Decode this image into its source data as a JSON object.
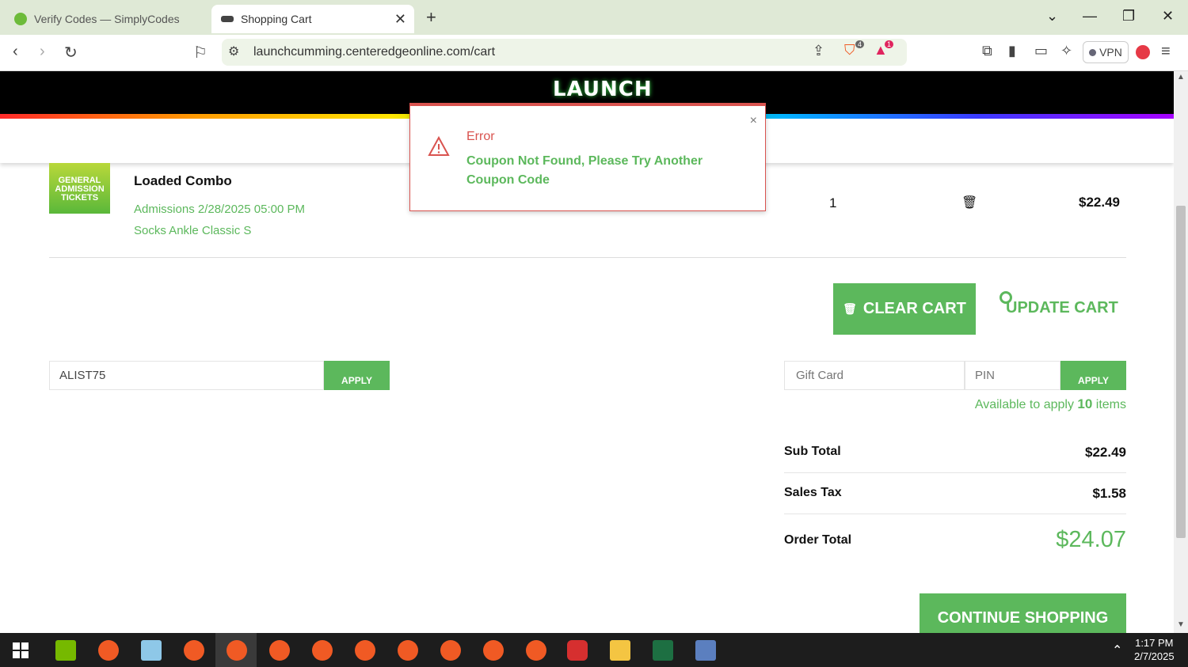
{
  "browser": {
    "tabs": [
      {
        "title": "Verify Codes — SimplyCodes",
        "active": false
      },
      {
        "title": "Shopping Cart",
        "active": true
      }
    ],
    "new_tab": "+",
    "url": "launchcumming.centeredgeonline.com/cart",
    "vpn_label": "VPN",
    "shield_badge": "4",
    "alert_badge": "1"
  },
  "site": {
    "logo": "LAUNCH"
  },
  "cart_item": {
    "thumb_text": "GENERAL ADMISSION TICKETS",
    "name": "Loaded Combo",
    "details": [
      "Admissions 2/28/2025 05:00 PM",
      "Socks Ankle Classic S"
    ],
    "quantity": "1",
    "price": "$22.49"
  },
  "actions": {
    "clear_cart": "CLEAR CART",
    "update_cart": "UPDATE CART",
    "continue_shopping": "CONTINUE SHOPPING"
  },
  "coupon": {
    "value": "ALIST75",
    "apply_label": "APPLY"
  },
  "gift_card": {
    "card_placeholder": "Gift Card",
    "pin_placeholder": "PIN",
    "apply_label": "APPLY",
    "available_prefix": "Available to apply",
    "available_count": "10",
    "available_suffix": "items"
  },
  "totals": {
    "subtotal_label": "Sub Total",
    "subtotal_value": "$22.49",
    "tax_label": "Sales Tax",
    "tax_value": "$1.58",
    "order_total_label": "Order Total",
    "order_total_value": "$24.07"
  },
  "error_modal": {
    "title": "Error",
    "message": "Coupon Not Found, Please Try Another Coupon Code",
    "close": "×"
  },
  "taskbar": {
    "time": "1:17 PM",
    "date": "2/7/2025"
  },
  "colors": {
    "accent_green": "#5cb85c",
    "error_red": "#d9534f"
  }
}
